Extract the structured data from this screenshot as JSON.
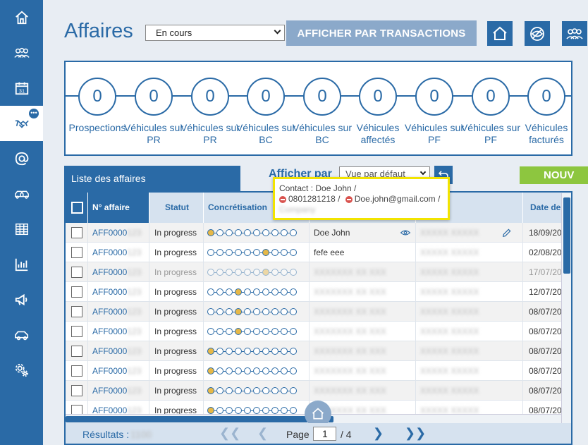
{
  "header": {
    "title": "Affaires",
    "status_select": "En cours",
    "transactions_button": "AFFICHER PAR TRANSACTIONS"
  },
  "sidebar": {
    "items": [
      {
        "name": "home-icon"
      },
      {
        "name": "group-icon"
      },
      {
        "name": "calendar-icon",
        "label": "31"
      },
      {
        "name": "handshake-icon",
        "badge": "•••",
        "active": true
      },
      {
        "name": "at-icon"
      },
      {
        "name": "cars-icon"
      },
      {
        "name": "table-icon"
      },
      {
        "name": "bar-chart-icon"
      },
      {
        "name": "megaphone-icon"
      },
      {
        "name": "car-icon"
      },
      {
        "name": "settings-icon"
      }
    ]
  },
  "funnel": {
    "stages": [
      {
        "count": "0",
        "label": "Prospections"
      },
      {
        "count": "0",
        "label": "Véhicules sur PR"
      },
      {
        "count": "0",
        "label": "Véhicules sur PR"
      },
      {
        "count": "0",
        "label": "Véhicules sur BC"
      },
      {
        "count": "0",
        "label": "Véhicules sur BC"
      },
      {
        "count": "0",
        "label": "Véhicules affectés"
      },
      {
        "count": "0",
        "label": "Véhicules sur PF"
      },
      {
        "count": "0",
        "label": "Véhicules sur PF"
      },
      {
        "count": "0",
        "label": "Véhicules facturés"
      }
    ]
  },
  "list": {
    "tab_label": "Liste des affaires",
    "afficher_par_label": "Afficher par",
    "view_select": "Vue par défaut",
    "new_button": "NOUV",
    "columns": [
      "N° affaire",
      "Statut",
      "Concrétisation",
      "",
      "",
      "Date de c"
    ],
    "rows": [
      {
        "id": "AFF0000",
        "status": "In progress",
        "step": 1,
        "contact": "Doe John",
        "date": "18/09/20"
      },
      {
        "id": "AFF0000",
        "status": "In progress",
        "step": 7,
        "contact": "fefe eee",
        "date": "02/08/20"
      },
      {
        "id": "AFF0000",
        "status": "In progress",
        "step": 7,
        "contact": "",
        "date": "17/07/20",
        "faded": true
      },
      {
        "id": "AFF0000",
        "status": "In progress",
        "step": 4,
        "contact": "",
        "date": "12/07/20"
      },
      {
        "id": "AFF0000",
        "status": "In progress",
        "step": 4,
        "contact": "",
        "date": "08/07/20"
      },
      {
        "id": "AFF0000",
        "status": "In progress",
        "step": 4,
        "contact": "",
        "date": "08/07/20"
      },
      {
        "id": "AFF0000",
        "status": "In progress",
        "step": 1,
        "contact": "",
        "date": "08/07/20"
      },
      {
        "id": "AFF0000",
        "status": "In progress",
        "step": 1,
        "contact": "",
        "date": "08/07/20"
      },
      {
        "id": "AFF0000",
        "status": "In progress",
        "step": 1,
        "contact": "",
        "date": "08/07/20"
      },
      {
        "id": "AFF0000",
        "status": "In progress",
        "step": 1,
        "contact": "",
        "date": "08/07/20"
      }
    ]
  },
  "pagination": {
    "results_label": "Résultats :",
    "page_label": "Page",
    "current_page": "1",
    "total_pages": "/ 4"
  },
  "tooltip": {
    "line1": "Contact : Doe John /",
    "phone": "0801281218 /",
    "email": "Doe.john@gmail.com /"
  },
  "colors": {
    "primary": "#2a6aa6",
    "light_button": "#8ba9ca",
    "header_row": "#d6e2ef",
    "accent_green": "#8dc63f",
    "tooltip_border": "#f2e400",
    "step_active": "#e7b847"
  }
}
